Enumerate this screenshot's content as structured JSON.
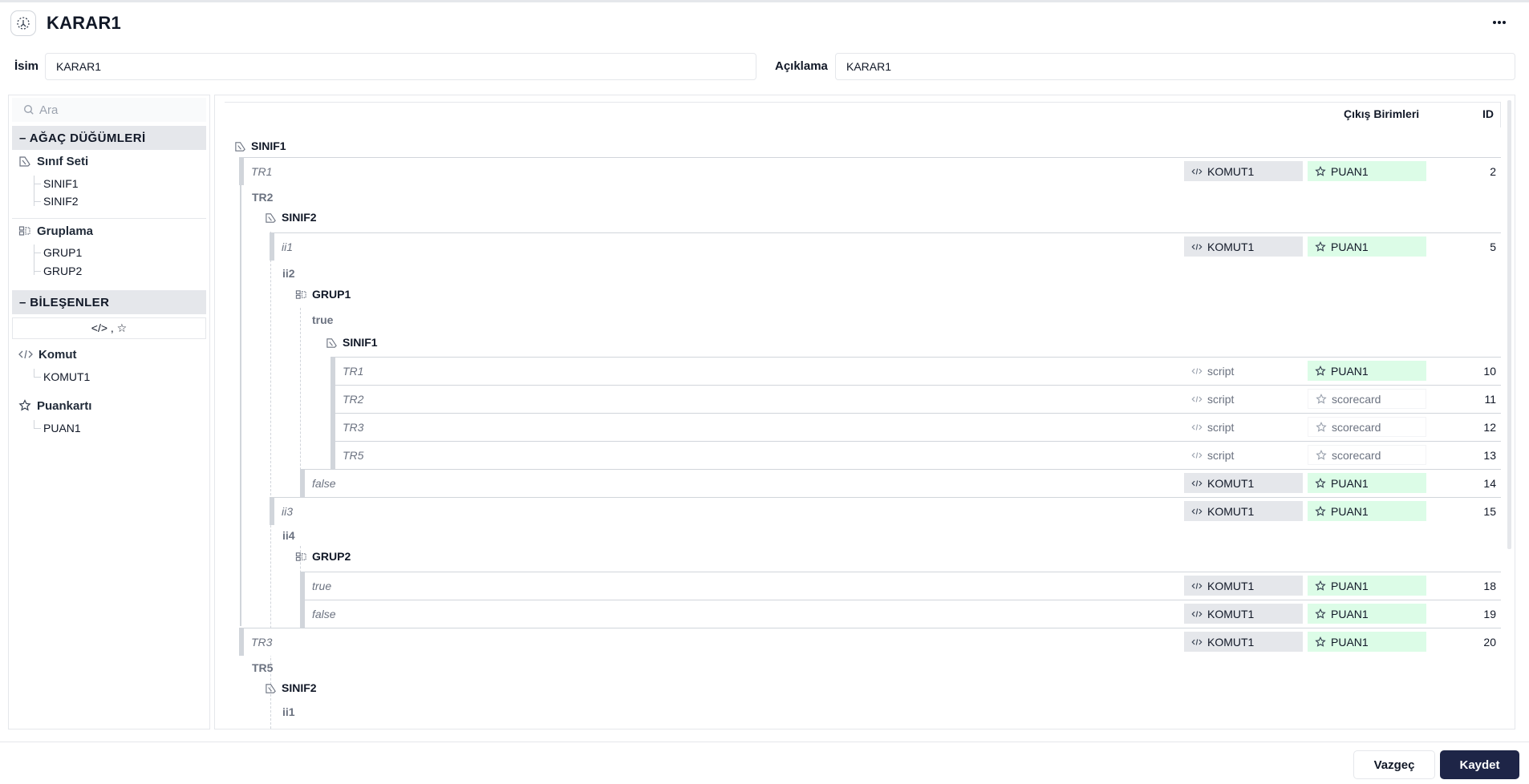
{
  "header": {
    "title": "KARAR1",
    "more_label": "•••"
  },
  "form": {
    "name_label": "İsim",
    "name_value": "KARAR1",
    "desc_label": "Açıklama",
    "desc_value": "KARAR1"
  },
  "sidebar": {
    "search_placeholder": "Ara",
    "tree_section": "– AĞAÇ DÜĞÜMLERİ",
    "class_set": {
      "label": "Sınıf Seti",
      "items": [
        "SINIF1",
        "SINIF2"
      ]
    },
    "grouping": {
      "label": "Gruplama",
      "items": [
        "GRUP1",
        "GRUP2"
      ]
    },
    "components_section": "– BİLEŞENLER",
    "filter_label": "</> , ☆",
    "command": {
      "label": "Komut",
      "items": [
        "KOMUT1"
      ]
    },
    "scorecard": {
      "label": "Puankartı",
      "items": [
        "PUAN1"
      ]
    }
  },
  "tree": {
    "col_output": "Çıkış Birimleri",
    "col_id": "ID",
    "nodes": {
      "n1": "SINIF1",
      "b_tr2": "TR2",
      "n2": "SINIF2",
      "b_ii2": "ii2",
      "n3": "GRUP1",
      "b_true": "true",
      "n4": "SINIF1",
      "b_ii4": "ii4",
      "n5": "GRUP2",
      "b_tr5": "TR5",
      "n6": "SINIF2",
      "b_ii1": "ii1"
    },
    "rows": {
      "r2": {
        "label": "TR1",
        "cmd": "KOMUT1",
        "score": "PUAN1",
        "id": "2"
      },
      "r5": {
        "label": "ii1",
        "cmd": "KOMUT1",
        "score": "PUAN1",
        "id": "5"
      },
      "r10": {
        "label": "TR1",
        "cmd": "script",
        "score": "PUAN1",
        "id": "10"
      },
      "r11": {
        "label": "TR2",
        "cmd": "script",
        "score": "scorecard",
        "id": "11"
      },
      "r12": {
        "label": "TR3",
        "cmd": "script",
        "score": "scorecard",
        "id": "12"
      },
      "r13": {
        "label": "TR5",
        "cmd": "script",
        "score": "scorecard",
        "id": "13"
      },
      "r14": {
        "label": "false",
        "cmd": "KOMUT1",
        "score": "PUAN1",
        "id": "14"
      },
      "r15": {
        "label": "ii3",
        "cmd": "KOMUT1",
        "score": "PUAN1",
        "id": "15"
      },
      "r18": {
        "label": "true",
        "cmd": "KOMUT1",
        "score": "PUAN1",
        "id": "18"
      },
      "r19": {
        "label": "false",
        "cmd": "KOMUT1",
        "score": "PUAN1",
        "id": "19"
      },
      "r20": {
        "label": "TR3",
        "cmd": "KOMUT1",
        "score": "PUAN1",
        "id": "20"
      }
    }
  },
  "footer": {
    "cancel_label": "Vazgeç",
    "save_label": "Kaydet"
  }
}
